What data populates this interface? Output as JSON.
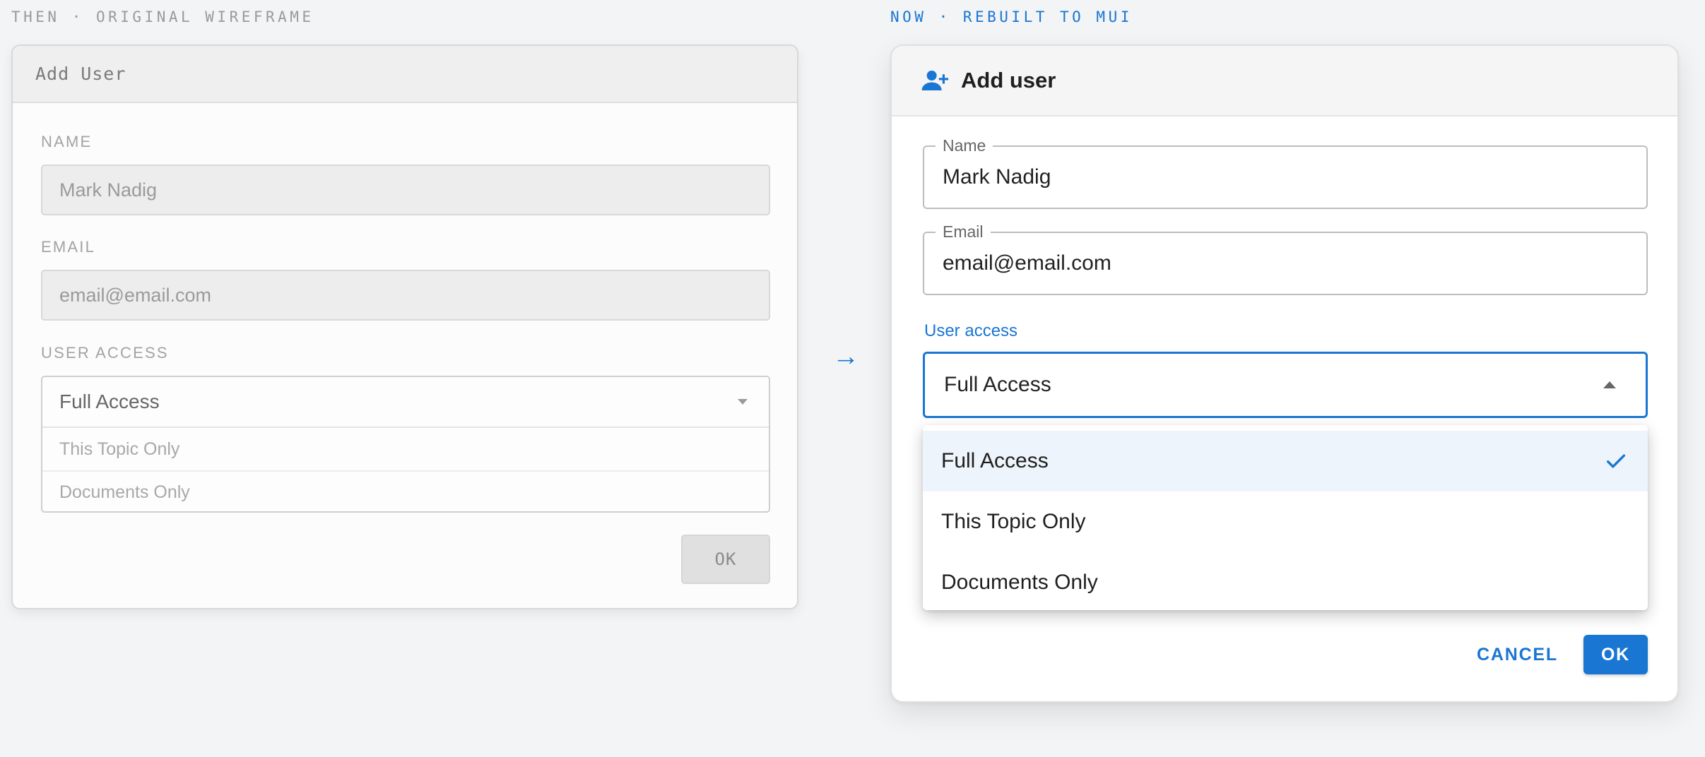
{
  "captions": {
    "then": "THEN · ORIGINAL WIREFRAME",
    "now": "NOW · REBUILT TO MUI"
  },
  "arrow": "→",
  "wireframe": {
    "title": "Add User",
    "name_label": "NAME",
    "name_value": "Mark Nadig",
    "email_label": "EMAIL",
    "email_value": "email@email.com",
    "access_label": "USER ACCESS",
    "access_selected": "Full Access",
    "access_options": [
      "This Topic Only",
      "Documents Only"
    ],
    "ok_label": "OK"
  },
  "mui": {
    "title": "Add user",
    "header_icon": "person-add-icon",
    "name_label": "Name",
    "name_value": "Mark Nadig",
    "email_label": "Email",
    "email_value": "email@email.com",
    "access_label": "User access",
    "access_selected": "Full Access",
    "menu_options": [
      "Full Access",
      "This Topic Only",
      "Documents Only"
    ],
    "selected_index": 0,
    "cancel_label": "CANCEL",
    "ok_label": "OK"
  },
  "colors": {
    "accent": "#1976d2",
    "background": "#f3f4f6",
    "selected_option_bg": "#edf4fb"
  }
}
